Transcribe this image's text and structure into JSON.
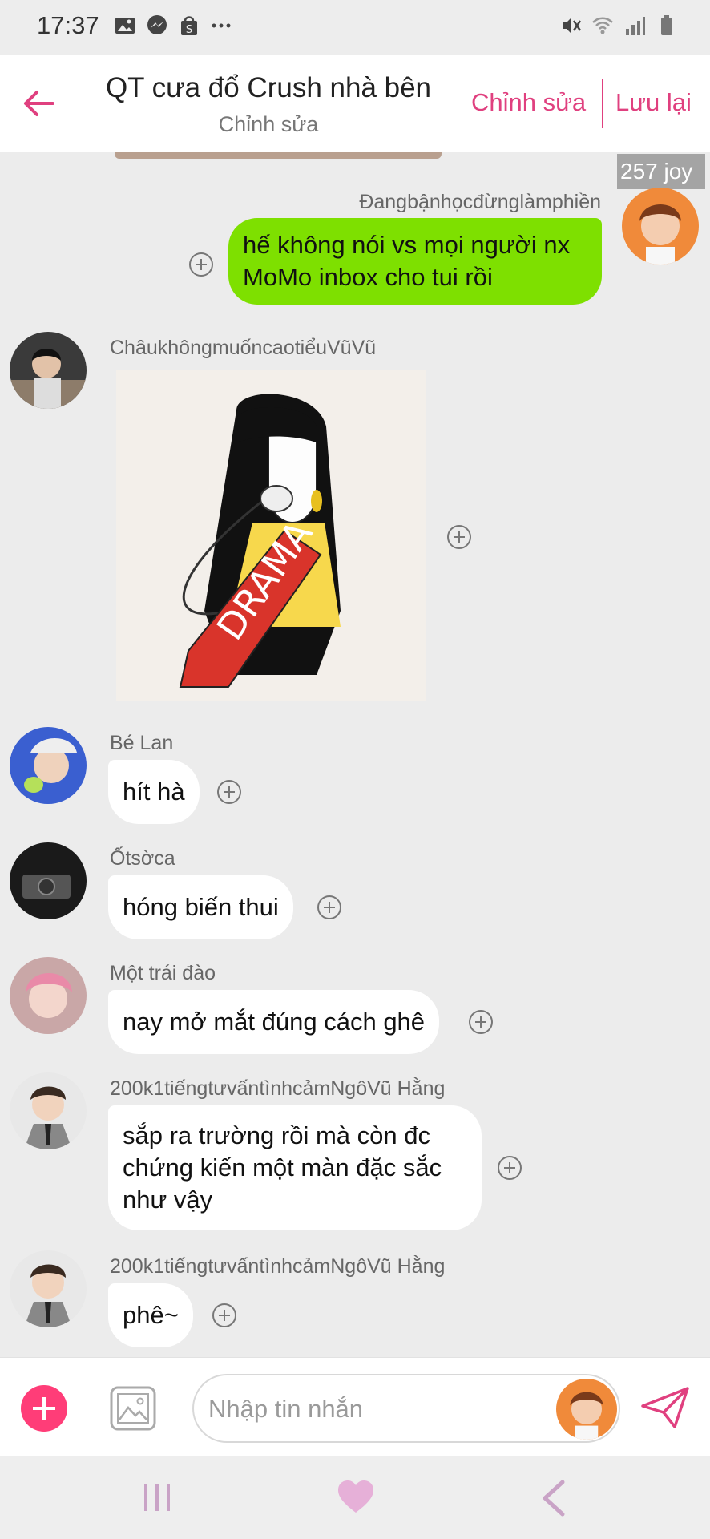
{
  "status_bar": {
    "time": "17:37",
    "left_icons": [
      "image-icon",
      "messenger-icon",
      "shopping-bag-icon",
      "more-dots-icon"
    ],
    "right_icons": [
      "mute-icon",
      "wifi-icon",
      "signal-icon",
      "battery-icon"
    ]
  },
  "header": {
    "title": "QT cưa đổ Crush nhà bên",
    "subtitle": "Chỉnh sửa",
    "edit_label": "Chỉnh sửa",
    "save_label": "Lưu lại",
    "accent_color": "#e0407f"
  },
  "joy_badge": "257 joy",
  "messages": [
    {
      "sender": "Đangbậnhọcđừnglàmphiền",
      "text_lines": [
        "hế không nói vs mọi người nx",
        "MoMo inbox cho tui rồi"
      ],
      "mine": true
    },
    {
      "sender": "ChâukhôngmuốncaotiểuVũVũ",
      "sticker_text": "DRAMA",
      "mine": false
    },
    {
      "sender": "Bé Lan",
      "text_lines": [
        "hít hà"
      ],
      "mine": false
    },
    {
      "sender": "Ốtsờca",
      "text_lines": [
        "hóng biến thui"
      ],
      "mine": false
    },
    {
      "sender": "Một trái đào",
      "text_lines": [
        "nay mở mắt đúng cách ghê"
      ],
      "mine": false
    },
    {
      "sender": "200k1tiếngtưvấntìnhcảmNgôVũ Hằng",
      "text_lines": [
        "sắp ra trường rồi mà còn đc",
        "chứng kiến một màn đặc sắc",
        "như vậy"
      ],
      "mine": false
    },
    {
      "sender": "200k1tiếngtưvấntìnhcảmNgôVũ Hằng",
      "text_lines": [
        "phê~"
      ],
      "mine": false
    }
  ],
  "input": {
    "placeholder": "Nhập tin nhắn"
  },
  "colors": {
    "my_bubble": "#7ee000",
    "other_bubble": "#ffffff",
    "add_button": "#ff3d78",
    "chat_background": "#ececec"
  }
}
